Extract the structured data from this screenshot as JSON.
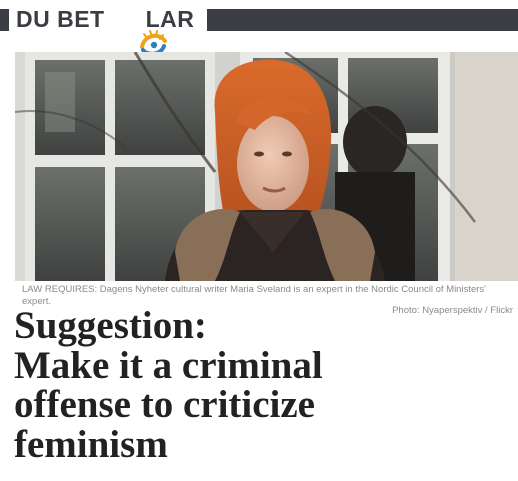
{
  "header": {
    "brand_left": "DU BET",
    "brand_right": "LAR",
    "logo_icon": "swirl-sun-logo",
    "bar_color": "#3a3d44",
    "logo_colors": [
      "#f2a21a",
      "#2f7fc1"
    ]
  },
  "article": {
    "photo_description_icon": "woman-at-window-photo",
    "caption": "LAW REQUIRES: Dagens Nyheter cultural writer Maria Sveland is an expert in the Nordic Council of Ministers' expert.",
    "credit": "Photo: Nyaperspektiv / Flickr",
    "headline_lines": [
      "Suggestion:",
      "Make it a criminal",
      "offense to criticize",
      "feminism"
    ]
  }
}
